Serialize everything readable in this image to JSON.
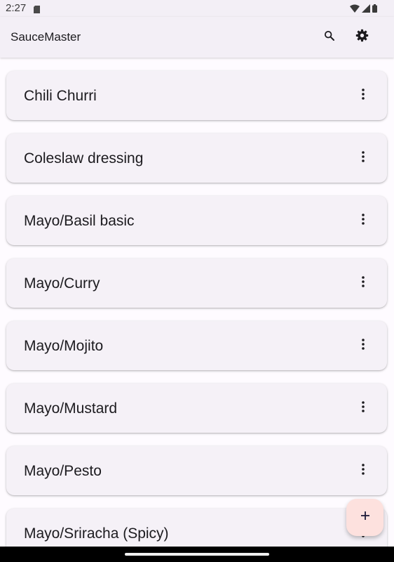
{
  "status_bar": {
    "time": "2:27",
    "icons": [
      "sd-card-icon",
      "wifi-icon",
      "cell-signal-icon",
      "battery-icon"
    ]
  },
  "app_bar": {
    "title": "SauceMaster",
    "actions": [
      "search-icon",
      "settings-icon"
    ]
  },
  "sauces": [
    {
      "name": "Chili Churri"
    },
    {
      "name": "Coleslaw dressing"
    },
    {
      "name": "Mayo/Basil basic"
    },
    {
      "name": "Mayo/Curry"
    },
    {
      "name": "Mayo/Mojito"
    },
    {
      "name": "Mayo/Mustard"
    },
    {
      "name": "Mayo/Pesto"
    },
    {
      "name": "Mayo/Sriracha (Spicy)"
    }
  ],
  "fab": {
    "icon": "add-icon",
    "symbol": "+"
  },
  "colors": {
    "background": "#fefbff",
    "app_bar": "#f3eff6",
    "card": "#f5f1f7",
    "fab": "#fde1de",
    "text": "#1c1b1f"
  }
}
